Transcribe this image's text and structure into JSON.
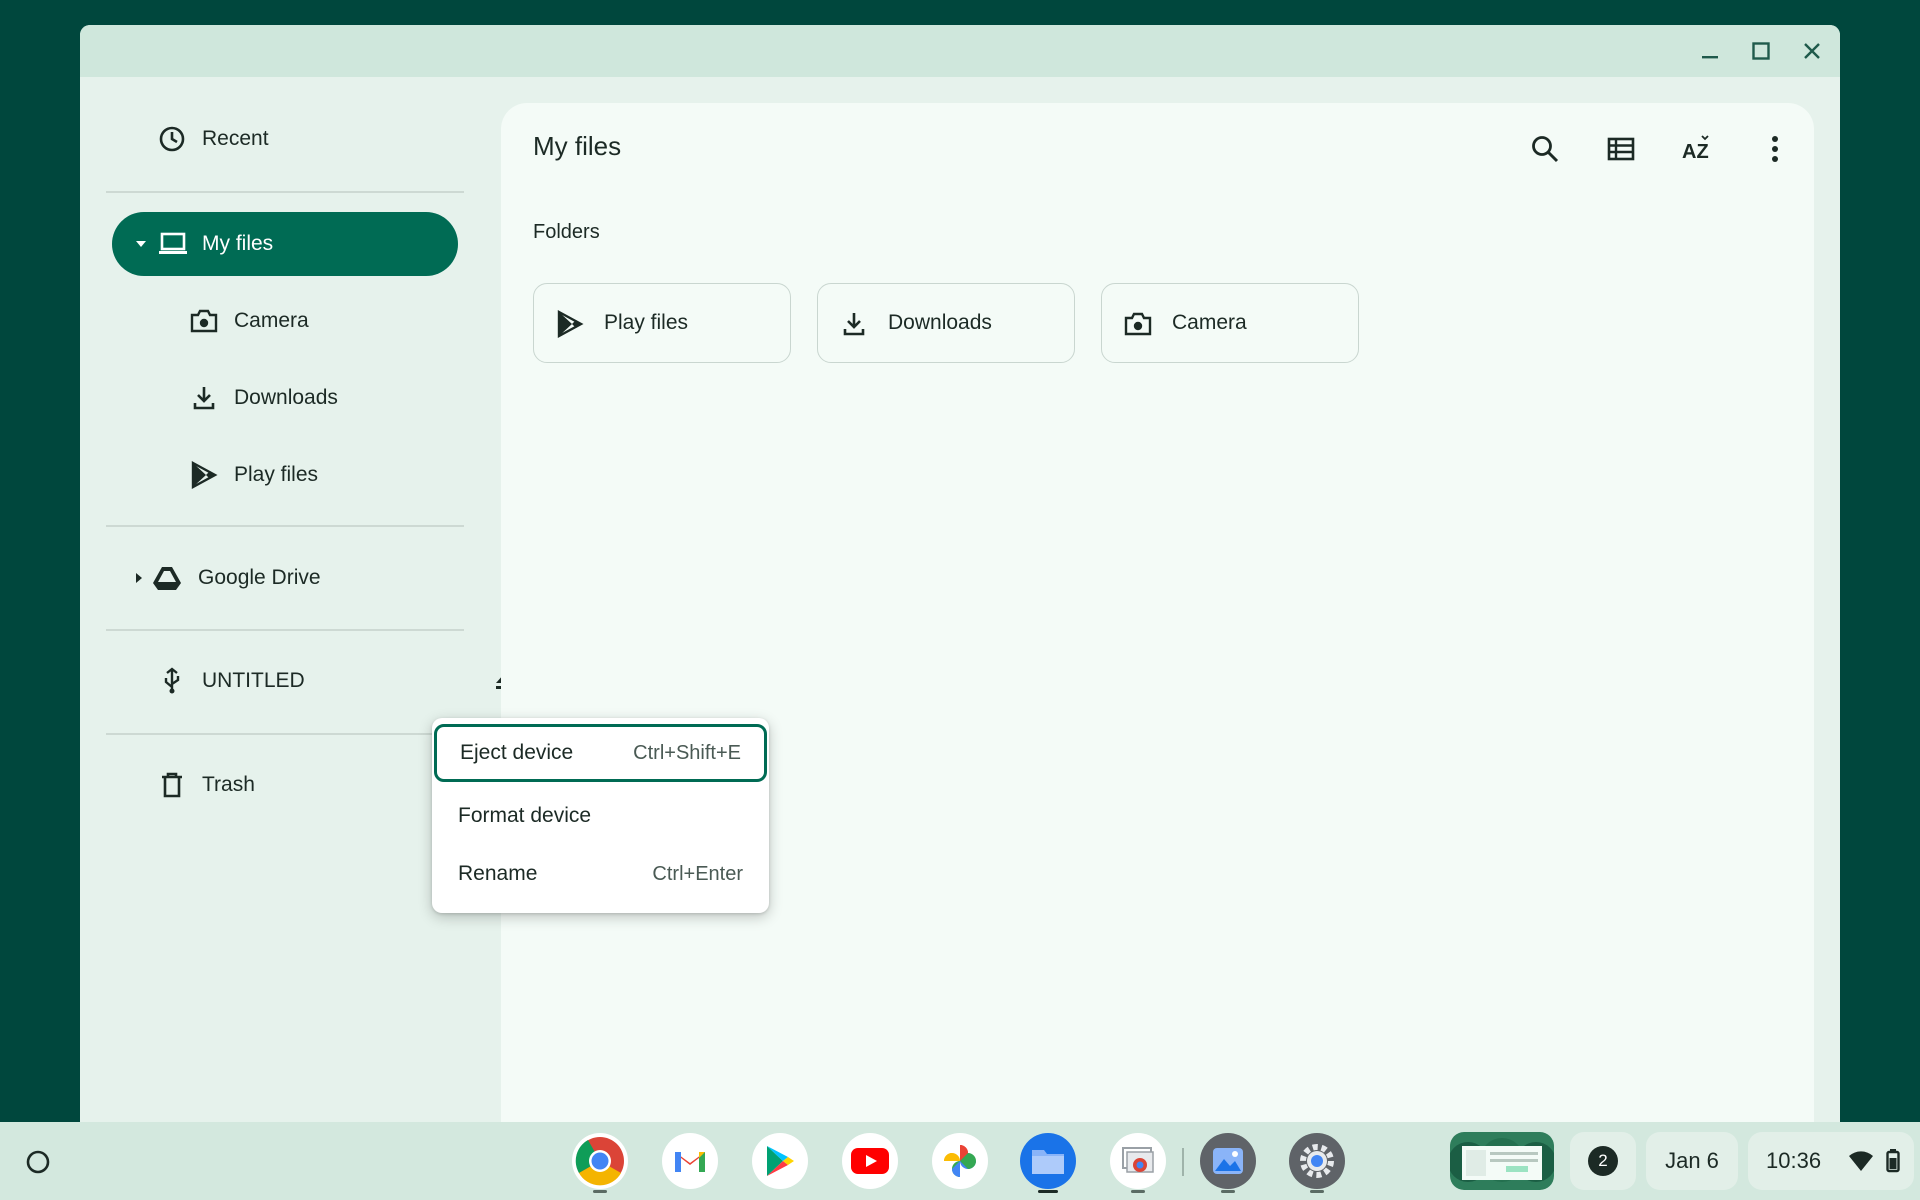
{
  "window": {
    "controls": {
      "minimize": "minimize-icon",
      "maximize": "maximize-icon",
      "close": "close-icon"
    }
  },
  "sidebar": {
    "recent": "Recent",
    "my_files": "My files",
    "camera": "Camera",
    "downloads": "Downloads",
    "play_files": "Play files",
    "google_drive": "Google Drive",
    "untitled": "UNTITLED",
    "trash": "Trash"
  },
  "main": {
    "title": "My files",
    "section": "Folders",
    "folders": [
      {
        "label": "Play files",
        "icon": "play-files-icon"
      },
      {
        "label": "Downloads",
        "icon": "download-icon"
      },
      {
        "label": "Camera",
        "icon": "camera-icon"
      }
    ]
  },
  "context_menu": {
    "items": [
      {
        "label": "Eject device",
        "shortcut": "Ctrl+Shift+E"
      },
      {
        "label": "Format device",
        "shortcut": ""
      },
      {
        "label": "Rename",
        "shortcut": "Ctrl+Enter"
      }
    ]
  },
  "shelf": {
    "apps": [
      "chrome",
      "gmail",
      "play-store",
      "youtube",
      "photos",
      "files",
      "screen-capture",
      "gallery",
      "settings"
    ],
    "notification_count": "2",
    "date": "Jan 6",
    "time": "10:36"
  },
  "colors": {
    "accent": "#006b54",
    "wallpaper": "#00473d",
    "surface": "#f4fbf7"
  }
}
